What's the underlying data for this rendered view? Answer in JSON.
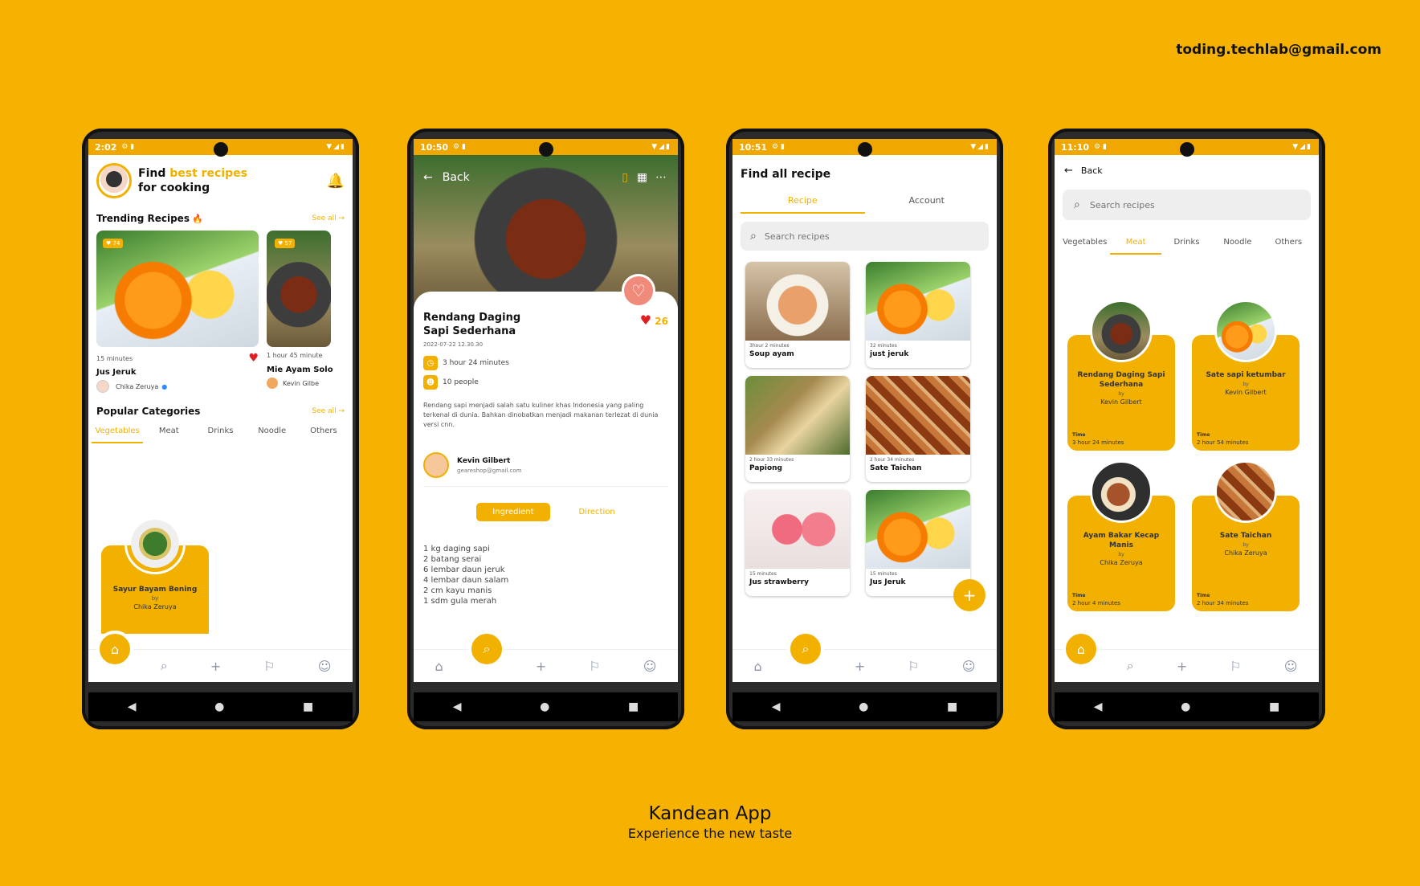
{
  "header": {
    "email": "toding.techlab@gmail.com"
  },
  "footer": {
    "title": "Kandean App",
    "subtitle": "Experience the new taste"
  },
  "colors": {
    "accent": "#F2B000",
    "background": "#F7B100"
  },
  "screen1": {
    "time": "2:02",
    "greeting_find": "Find ",
    "greeting_highlight": "best recipes",
    "greeting_rest": "for cooking",
    "trending_title": "Trending Recipes",
    "see_all": "See all",
    "trending": [
      {
        "likes": "74",
        "duration": "15 minutes",
        "name": "Jus Jeruk",
        "author": "Chika Zeruya"
      },
      {
        "likes": "57",
        "duration": "1 hour 45 minute",
        "name": "Mie Ayam Solo",
        "author": "Kevin Gilbe"
      }
    ],
    "popular_title": "Popular Categories",
    "categories": [
      "Vegetables",
      "Meat",
      "Drinks",
      "Noodle",
      "Others"
    ],
    "category_card": {
      "name": "Sayur Bayam Bening",
      "by": "by",
      "author": "Chika Zeruya"
    }
  },
  "screen2": {
    "time": "10:50",
    "back": "Back",
    "title": "Rendang Daging Sapi Sederhana",
    "date": "2022-07-22  12.30.30",
    "likes": "26",
    "duration": "3 hour 24 minutes",
    "people": "10 people",
    "description": "Rendang sapi menjadi salah satu kuliner khas Indonesia yang paling terkenal di dunia. Bahkan dinobatkan menjadi makanan terlezat di dunia versi cnn.",
    "author": "Kevin Gilbert",
    "author_email": "geareshop@gmail.com",
    "tab_ingredient": "Ingredient",
    "tab_direction": "Direction",
    "ingredients": [
      "1 kg daging sapi",
      "2 batang serai",
      "6 lembar daun jeruk",
      "4 lembar daun salam",
      "2 cm kayu manis",
      "1 sdm gula merah"
    ]
  },
  "screen3": {
    "time": "10:51",
    "title": "Find all recipe",
    "tabs": [
      "Recipe",
      "Account"
    ],
    "search_placeholder": "Search recipes",
    "recipes": [
      {
        "duration": "3hour 2 minutes",
        "name": "Soup ayam"
      },
      {
        "duration": "32 minutes",
        "name": "just jeruk"
      },
      {
        "duration": "2 hour 33 minutes",
        "name": "Papiong"
      },
      {
        "duration": "2 hour 34 minutes",
        "name": "Sate Taichan"
      },
      {
        "duration": "15 minutes",
        "name": "Jus strawberry"
      },
      {
        "duration": "15 minutes",
        "name": "Jus Jeruk"
      }
    ]
  },
  "screen4": {
    "time": "11:10",
    "back": "Back",
    "search_placeholder": "Search recipes",
    "tabs": [
      "Vegetables",
      "Meat",
      "Drinks",
      "Noodle",
      "Others"
    ],
    "time_label": "Time",
    "by": "by",
    "cards": [
      {
        "name": "Rendang Daging Sapi Sederhana",
        "author": "Kevin Gilbert",
        "time": "3 hour 24 minutes"
      },
      {
        "name": "Sate sapi ketumbar",
        "author": "Kevin Gilbert",
        "time": "2 hour 54 minutes"
      },
      {
        "name": "Ayam Bakar Kecap Manis",
        "author": "Chika Zeruya",
        "time": "2 hour 4 minutes"
      },
      {
        "name": "Sate Taichan",
        "author": "Chika Zeruya",
        "time": "2 hour 34 minutes"
      }
    ]
  }
}
